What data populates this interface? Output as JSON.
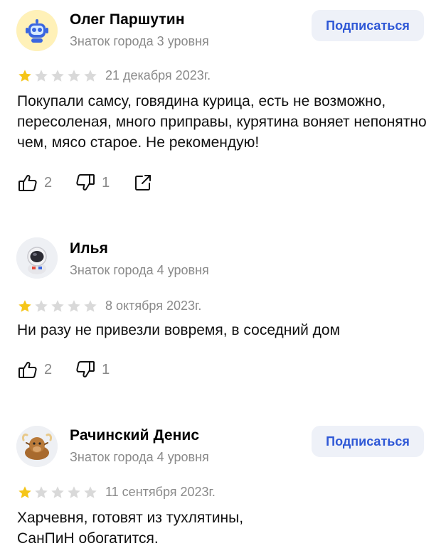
{
  "colors": {
    "star_filled": "#f5c518",
    "star_empty": "#d9d9d9",
    "accent": "#2f58d6",
    "muted": "#8a8a8a"
  },
  "reviews": [
    {
      "author": "Олег Паршутин",
      "level": "Знаток города 3 уровня",
      "avatar_icon": "robot-avatar-icon",
      "subscribe": "Подписаться",
      "rating": 1,
      "max_rating": 5,
      "date": "21 декабря 2023г.",
      "text": "Покупали самсу, говядина курица, есть не возможно, пересоленая, много приправы, курятина воняет непонятно чем, мясо старое. Не рекомендую!",
      "likes": "2",
      "dislikes": "1",
      "share_icon": "share-icon"
    },
    {
      "author": "Илья",
      "level": "Знаток города 4 уровня",
      "avatar_icon": "astronaut-avatar-icon",
      "rating": 1,
      "max_rating": 5,
      "date": "8 октября 2023г.",
      "text": "Ни разу не привезли вовремя, в соседний дом",
      "likes": "2",
      "dislikes": "1"
    },
    {
      "author": "Рачинский Денис",
      "level": "Знаток города 4 уровня",
      "avatar_icon": "yak-avatar-icon",
      "subscribe": "Подписаться",
      "rating": 1,
      "max_rating": 5,
      "date": "11 сентября 2023г.",
      "text": "Харчевня, готовят из тухлятины, СанПиН обогатится."
    }
  ]
}
